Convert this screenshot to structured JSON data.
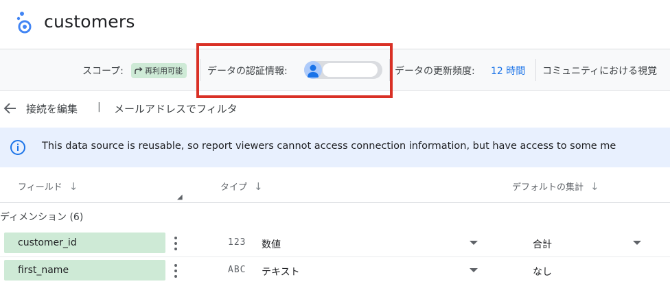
{
  "header": {
    "title": "customers"
  },
  "infobar": {
    "scope_label": "スコープ:",
    "scope_chip": "再利用可能",
    "credentials_label": "データの認証情報:",
    "refresh_label": "データの更新頻度:",
    "refresh_value": "12 時間",
    "community_label": "コミュニティにおける視覚"
  },
  "breadcrumb": {
    "edit_connection": "接続を編集",
    "separator": "|",
    "filter_by_email": "メールアドレスでフィルタ"
  },
  "banner": {
    "text": "This data source is reusable, so report viewers cannot access connection information, but have access to some me"
  },
  "columns": {
    "field": "フィールド",
    "type": "タイプ",
    "default_aggregation": "デフォルトの集計",
    "sort_glyph": "↓"
  },
  "group": {
    "label": "ディメンション (6)"
  },
  "rows": [
    {
      "field": "customer_id",
      "type_icon": "123",
      "type": "数値",
      "aggregation": "合計"
    },
    {
      "field": "first_name",
      "type_icon": "ABC",
      "type": "テキスト",
      "aggregation": "なし"
    }
  ],
  "colors": {
    "accent": "#1a73e8",
    "chip_green": "#ceead6",
    "banner_blue": "#e8f0fe",
    "highlight_red": "#d93025"
  },
  "icons": {
    "logo": "looker-studio-logo-icon",
    "scope": "reshare-arrow-icon",
    "credentials": "person-avatar-icon",
    "back": "arrow-back-icon",
    "info": "info-icon",
    "more": "more-vert-icon",
    "dropdown": "caret-down-icon"
  }
}
